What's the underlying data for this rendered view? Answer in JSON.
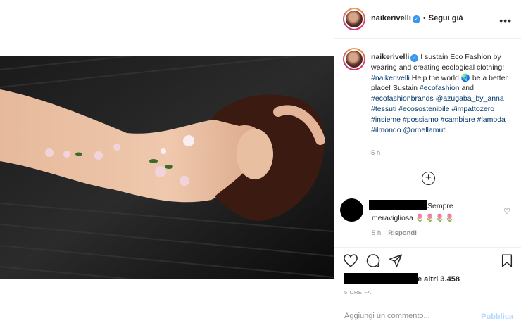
{
  "post": {
    "username": "naikerivelli",
    "follow_label": "Segui già",
    "caption": {
      "intro": "I sustain Eco Fashion by wearing and creating ecological clothing!",
      "tag1": "#naikerivelli",
      "mid": "Help the world",
      "emoji": "🌏",
      "mid2": "be a better place! Sustain",
      "tag2": "#ecofashion",
      "and": "and",
      "tag3": "#ecofashionbrands",
      "tag4": "@azugaba_by_anna",
      "tag5": "#tessuti",
      "tag6": "#ecosostenibile",
      "tag7": "#impattozero",
      "tag8": "#insieme",
      "tag9": "#possiamo",
      "tag10": "#cambiare",
      "tag11": "#lamoda",
      "tag12": "#ilmondo",
      "tag13": "@ornellamuti",
      "time": "5 h"
    },
    "comment": {
      "text_part1": "Sempre",
      "text_part2": "meravigliosa",
      "emojis": "🌷🌷🌷🌷",
      "time": "5 h",
      "reply_label": "Rispondi"
    },
    "likes_text": "e altri 3.458",
    "posted_ago": "5 ORE FA",
    "add_comment_placeholder": "Aggiungi un commento...",
    "publish_label": "Pubblica"
  },
  "icons": [
    "more-icon",
    "verified-icon",
    "plus-circle-icon",
    "heart-icon",
    "comment-icon",
    "share-icon",
    "bookmark-icon"
  ],
  "colors": {
    "link": "#00376b",
    "verified": "#3897f0",
    "muted": "#8e8e8e",
    "publish": "#b3dbff"
  }
}
